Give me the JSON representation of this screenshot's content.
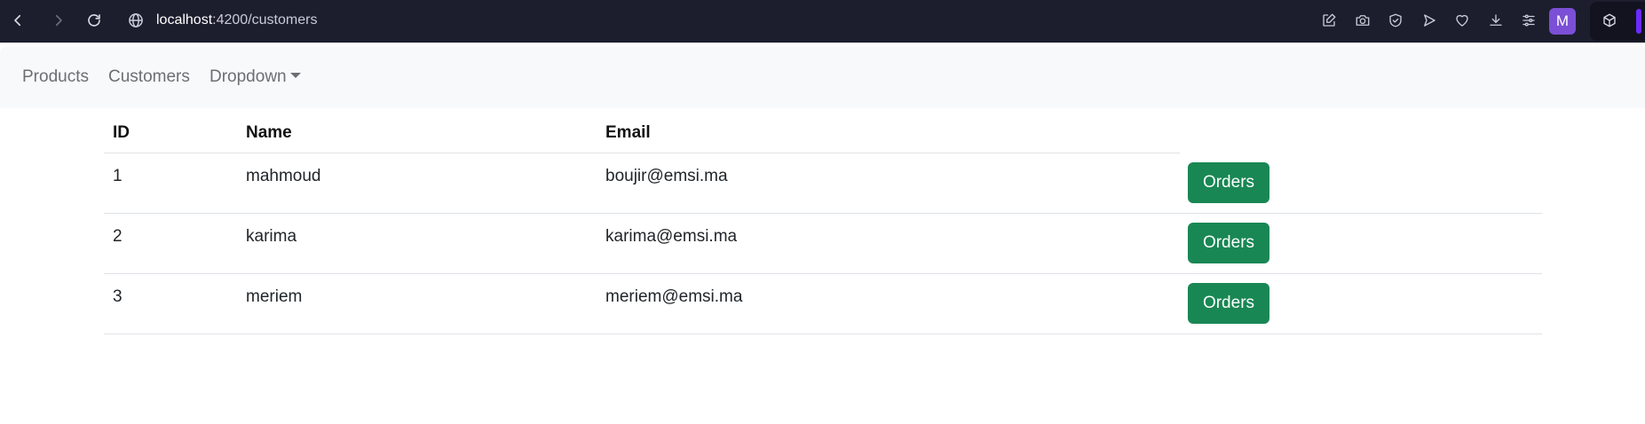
{
  "browser": {
    "url_host": "localhost",
    "url_path": ":4200/customers",
    "profile_initial": "M",
    "icons": [
      "back-icon",
      "forward-icon",
      "reload-icon",
      "site-info-icon",
      "edit-icon",
      "camera-icon",
      "shield-icon",
      "send-icon",
      "heart-icon",
      "download-icon",
      "settings-sliders-icon",
      "extension-cube-icon"
    ],
    "accent_color": "#6a2bff",
    "chrome_color": "#1c1e2e"
  },
  "nav": {
    "links": [
      {
        "label": "Products"
      },
      {
        "label": "Customers"
      },
      {
        "label": "Dropdown"
      }
    ]
  },
  "table": {
    "headers": [
      "ID",
      "Name",
      "Email"
    ],
    "rows": [
      {
        "id": "1",
        "name": "mahmoud",
        "email": "boujir@emsi.ma",
        "action": "Orders"
      },
      {
        "id": "2",
        "name": "karima",
        "email": "karima@emsi.ma",
        "action": "Orders"
      },
      {
        "id": "3",
        "name": "meriem",
        "email": "meriem@emsi.ma",
        "action": "Orders"
      }
    ],
    "action_color": "#198754"
  }
}
